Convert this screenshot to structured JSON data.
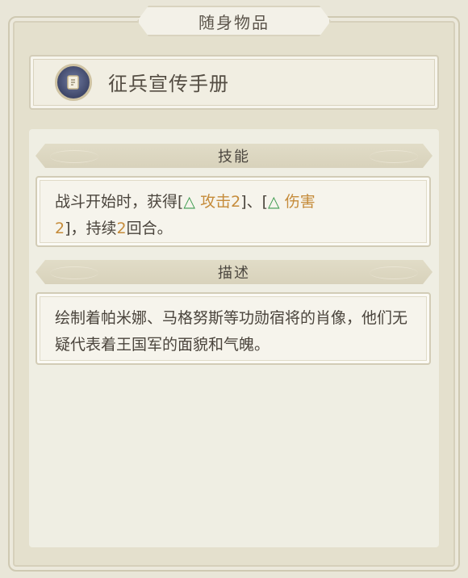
{
  "header": {
    "title": "随身物品"
  },
  "item": {
    "icon": "scroll-badge-icon",
    "name": "征兵宣传手册"
  },
  "skill": {
    "heading": "技能",
    "text_1": "战斗开始时，获得[",
    "buff1_icon": "△",
    "buff1_name": "攻击2",
    "text_2": "]、[",
    "buff2_icon": "△",
    "buff2_name": "伤害",
    "buff2_value": "2",
    "text_3": "]，持续",
    "duration": "2",
    "text_4": "回合。"
  },
  "description": {
    "heading": "描述",
    "text": "绘制着帕米娜、马格努斯等功勋宿将的肖像，他们无疑代表着王国军的面貌和气魄。"
  },
  "colors": {
    "highlight": "#c58b3a",
    "buff_icon": "#3b9a4e"
  }
}
